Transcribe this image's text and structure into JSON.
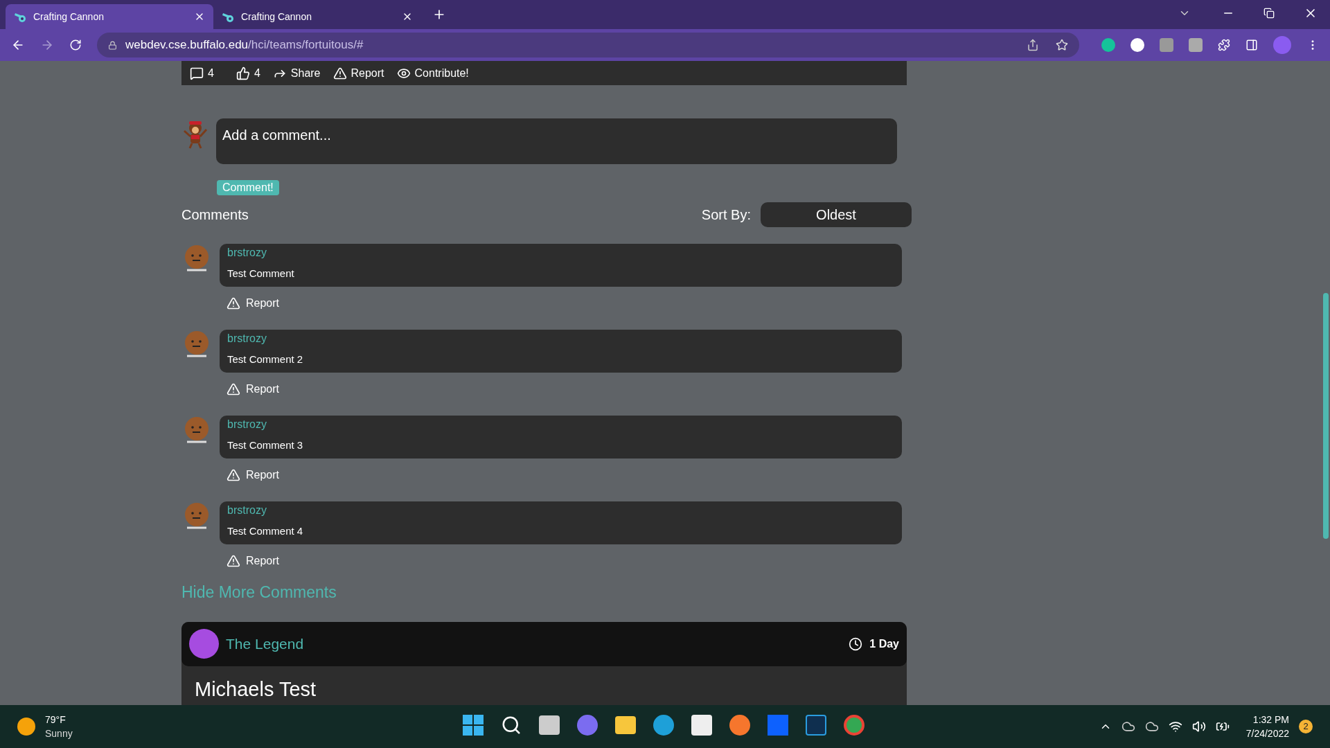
{
  "browser": {
    "tabs": [
      {
        "label": "Crafting Cannon",
        "selected": true
      },
      {
        "label": "Crafting Cannon",
        "selected": false
      }
    ],
    "url_host": "webdev.cse.buffalo.edu",
    "url_path": "/hci/teams/fortuitous/#"
  },
  "post_actions": [
    {
      "kind": "comments",
      "label": "4"
    },
    {
      "kind": "likes",
      "label": "4"
    },
    {
      "kind": "share",
      "label": "Share"
    },
    {
      "kind": "report",
      "label": "Report"
    },
    {
      "kind": "contribute",
      "label": "Contribute!"
    }
  ],
  "comment_form": {
    "placeholder": "Add a comment...",
    "button": "Comment!"
  },
  "comments_section": {
    "title": "Comments",
    "sort_label": "Sort By:",
    "sort_value": "Oldest"
  },
  "comments": [
    {
      "author": "brstrozy",
      "text": "Test Comment",
      "report": "Report"
    },
    {
      "author": "brstrozy",
      "text": "Test Comment 2",
      "report": "Report"
    },
    {
      "author": "brstrozy",
      "text": "Test Comment 3",
      "report": "Report"
    },
    {
      "author": "brstrozy",
      "text": "Test Comment 4",
      "report": "Report"
    }
  ],
  "hide_link": "Hide More Comments",
  "next_post": {
    "author": "The Legend",
    "age": "1 Day",
    "title": "Michaels Test"
  },
  "taskbar": {
    "temperature": "79°F",
    "weather": "Sunny",
    "time": "1:32 PM",
    "date": "7/24/2022",
    "notifications": "2"
  }
}
